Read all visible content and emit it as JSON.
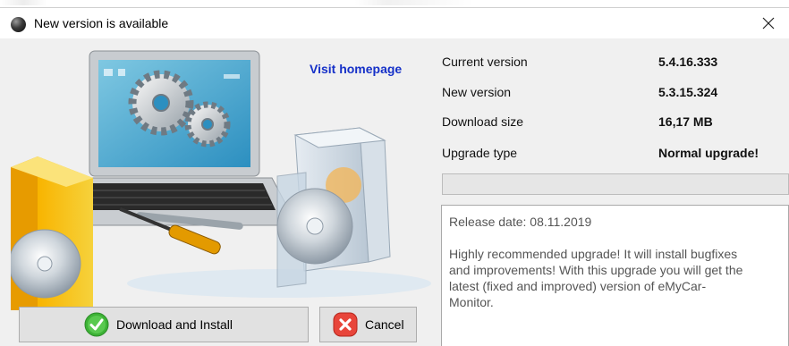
{
  "window": {
    "title": "New version is available",
    "app_icon": "app-sphere-icon",
    "close_icon": "close-icon"
  },
  "header": {
    "visit_homepage": "Visit homepage"
  },
  "info": {
    "rows": [
      {
        "label": "Current version",
        "value": "5.4.16.333"
      },
      {
        "label": "New version",
        "value": "5.3.15.324"
      },
      {
        "label": "Download size",
        "value": "16,17 MB"
      },
      {
        "label": "Upgrade type",
        "value": "Normal upgrade!"
      }
    ]
  },
  "progress": {
    "value": 0
  },
  "notes": {
    "release_date": "Release date: 08.11.2019",
    "body": "Highly recommended upgrade! It will install bugfixes\nand improvements! With this upgrade you will get the\nlatest (fixed and improved) version of eMyCar-\nMonitor."
  },
  "buttons": {
    "download_label": "Download and Install",
    "download_icon": "check-circle-icon",
    "cancel_label": "Cancel",
    "cancel_icon": "x-circle-icon"
  },
  "colors": {
    "link": "#1530c8",
    "ok_green": "#3db236",
    "cancel_red": "#e8453a"
  }
}
